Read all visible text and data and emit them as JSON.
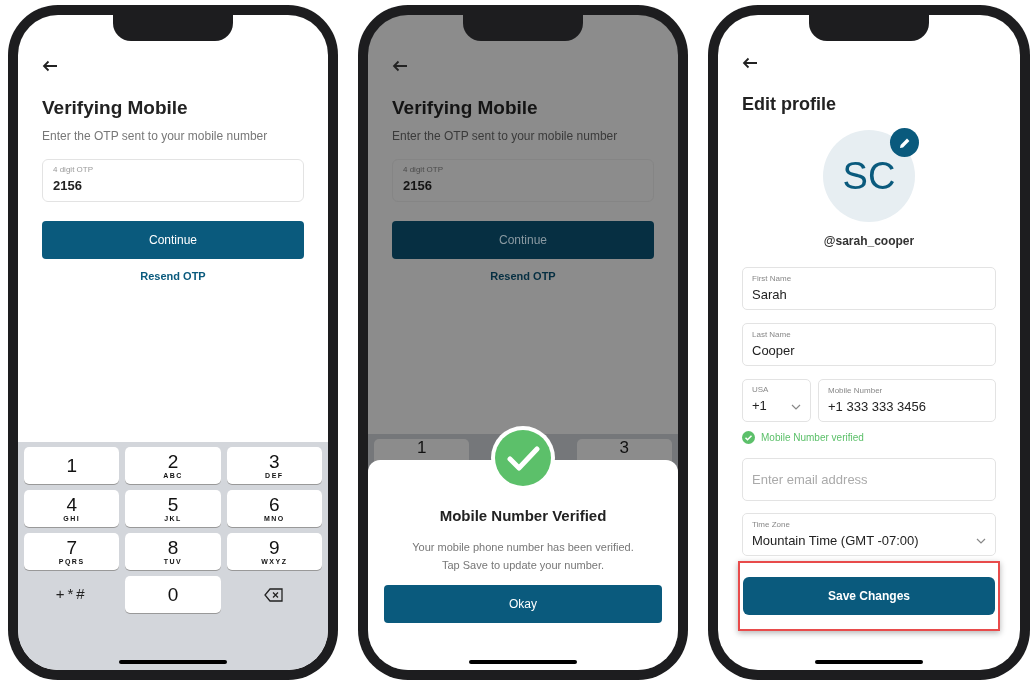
{
  "screens": [
    {
      "kind": "otp",
      "title": "Verifying Mobile",
      "subtitle": "Enter the OTP sent to your mobile number",
      "otp_field": {
        "label": "4 digit OTP",
        "value": "2156"
      },
      "continue_button": "Continue",
      "resend_link": "Resend OTP",
      "keypad": [
        {
          "digit": "1"
        },
        {
          "digit": "2",
          "letters": "ABC"
        },
        {
          "digit": "3",
          "letters": "DEF"
        },
        {
          "digit": "4",
          "letters": "GHI"
        },
        {
          "digit": "5",
          "letters": "JKL"
        },
        {
          "digit": "6",
          "letters": "MNO"
        },
        {
          "digit": "7",
          "letters": "PQRS"
        },
        {
          "digit": "8",
          "letters": "TUV"
        },
        {
          "digit": "9",
          "letters": "WXYZ"
        },
        {
          "kind": "symbols",
          "digit": "+*#"
        },
        {
          "digit": "0"
        },
        {
          "kind": "backspace"
        }
      ]
    },
    {
      "kind": "verified",
      "dimmed": true,
      "title": "Verifying Mobile",
      "subtitle": "Enter the OTP sent to your mobile number",
      "otp_field": {
        "label": "4 digit OTP",
        "value": "2156"
      },
      "continue_button": "Continue",
      "resend_link": "Resend OTP",
      "keypad_peek": [
        "1",
        "3"
      ],
      "dialog": {
        "title": "Mobile Number Verified",
        "message": "Your mobile phone number has been verified. Tap Save to update your number.",
        "button": "Okay"
      }
    },
    {
      "kind": "profile",
      "title": "Edit profile",
      "initials": "SC",
      "username": "@sarah_cooper",
      "first_name": {
        "label": "First Name",
        "value": "Sarah"
      },
      "last_name": {
        "label": "Last Name",
        "value": "Cooper"
      },
      "country": {
        "label": "USA",
        "value": "+1"
      },
      "mobile": {
        "label": "Mobile Number",
        "value": "+1 333 333 3456"
      },
      "verified_note": "Mobile Number verified",
      "email": {
        "placeholder": "Enter email address"
      },
      "time_zone": {
        "label": "Time Zone",
        "value": "Mountain Time (GMT -07:00)"
      },
      "save_button": {
        "label": "Save Changes",
        "highlighted": true
      }
    }
  ]
}
